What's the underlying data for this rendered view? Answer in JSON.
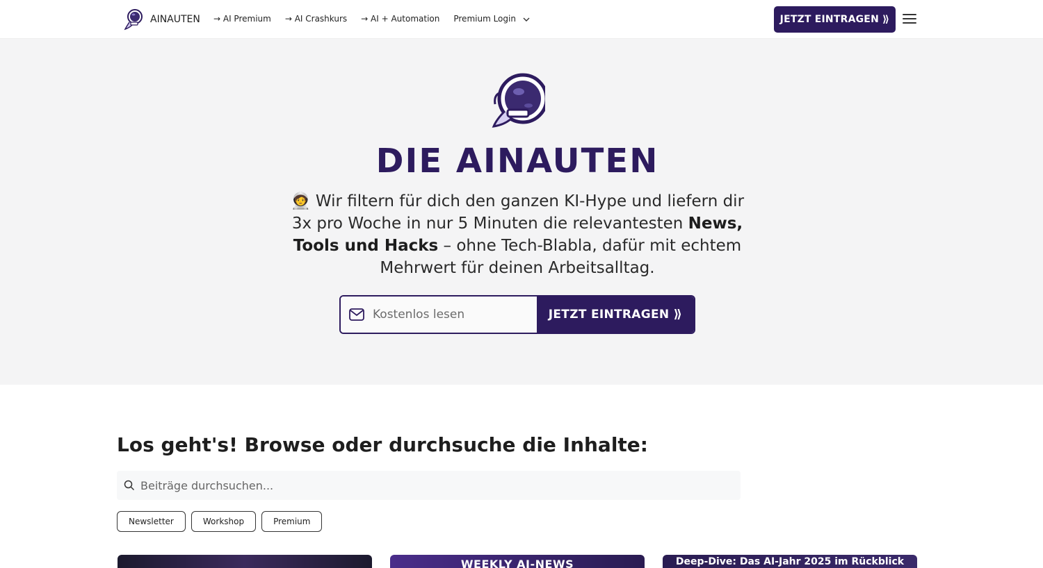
{
  "header": {
    "brand": "AINAUTEN",
    "nav": [
      {
        "label": "→ AI Premium"
      },
      {
        "label": "→ AI Crashkurs"
      },
      {
        "label": "→ AI + Automation"
      },
      {
        "label": "Premium Login"
      }
    ],
    "cta_label": "JETZT EINTRAGEN ⟫"
  },
  "hero": {
    "title": "DIE AINAUTEN",
    "text_part1": "🧑‍🚀 Wir filtern für dich den ganzen KI-Hype und liefern dir 3x pro Woche in nur 5 Minuten die relevantesten ",
    "text_bold": "News, Tools und Hacks",
    "text_part2": " – ohne Tech-Blabla, dafür mit echtem Mehrwert für deinen Arbeitsalltag.",
    "input_placeholder": "Kostenlos lesen",
    "button_label": "JETZT EINTRAGEN ⟫"
  },
  "browse": {
    "title": "Los geht's! Browse oder durchsuche die Inhalte:",
    "search_placeholder": "Beiträge durchsuchen...",
    "filters": [
      "Newsletter",
      "Workshop",
      "Premium"
    ]
  },
  "cards": [
    {
      "caption": ""
    },
    {
      "caption": "WEEKLY AI-NEWS"
    },
    {
      "caption": "Deep-Dive: Das AI-Jahr 2025 im Rückblick"
    }
  ],
  "colors": {
    "brand": "#2d1b5e",
    "hero_bg": "#f4f4f5"
  }
}
